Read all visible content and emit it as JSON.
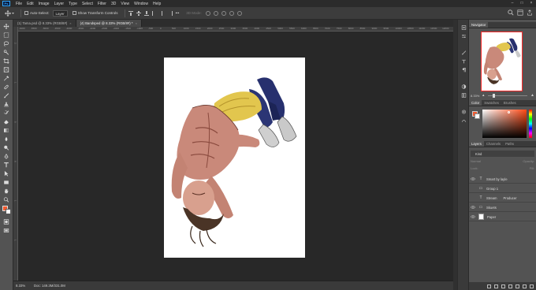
{
  "app": {
    "logo": "Ps",
    "menu": [
      "File",
      "Edit",
      "Image",
      "Layer",
      "Type",
      "Select",
      "Filter",
      "3D",
      "View",
      "Window",
      "Help"
    ],
    "window_controls": [
      "–",
      "□",
      "×"
    ]
  },
  "options_bar": {
    "auto_select_label": "Auto-Select:",
    "auto_select_value": "Layer",
    "transform_controls_label": "Show Transform Controls",
    "mode_3d_label": "3D Mode:"
  },
  "tabs": [
    {
      "title": "(1) Tama.psd @ 8.33% (RGB/8#)",
      "active": false
    },
    {
      "title": "(4) Bandsped @ 8.33% (RGB/8#) *",
      "active": true
    }
  ],
  "ruler": {
    "top_ticks": [
      "-6000",
      "-5500",
      "-5000",
      "-4500",
      "-4000",
      "-3500",
      "-3000",
      "-2500",
      "-2000",
      "-1500",
      "-1000",
      "-500",
      "0",
      "500",
      "1000",
      "1500",
      "2000",
      "2500",
      "3000",
      "3500",
      "4000",
      "4500",
      "5000",
      "5500",
      "6000",
      "6500",
      "7000",
      "7500",
      "8000",
      "8500",
      "9000",
      "9500",
      "10000",
      "10500",
      "11000",
      "11500",
      "12000"
    ]
  },
  "status": {
    "zoom": "8.33%",
    "doc_info": "Doc: 149.3M/331.0M"
  },
  "navigator": {
    "tab": "Navigator",
    "zoom": "8.33%"
  },
  "color_panel": {
    "tabs": [
      "Color",
      "Swatches",
      "Brushes"
    ],
    "foreground": "#f15a30",
    "background": "#ffffff"
  },
  "layers_panel": {
    "tabs": [
      "Layers",
      "Channels",
      "Paths"
    ],
    "filter_kind": "Kind",
    "blend_mode": "Normal",
    "opacity_label": "Opacity:",
    "lock_label": "Lock:",
    "fill_label": "Fill:",
    "layers": [
      {
        "name": "Smart by layle",
        "kind": "text",
        "visible": true
      },
      {
        "name": "Group 1",
        "kind": "folder",
        "visible": false
      },
      {
        "name": "Stream",
        "extra": "Producer",
        "kind": "text",
        "visible": false
      },
      {
        "name": "Skuets",
        "kind": "folder",
        "visible": true
      },
      {
        "name": "Paper",
        "kind": "pixel",
        "visible": true
      }
    ]
  },
  "colors": {
    "accent_blue": "#31a8ff",
    "nav_frame": "#ff2a2a"
  }
}
